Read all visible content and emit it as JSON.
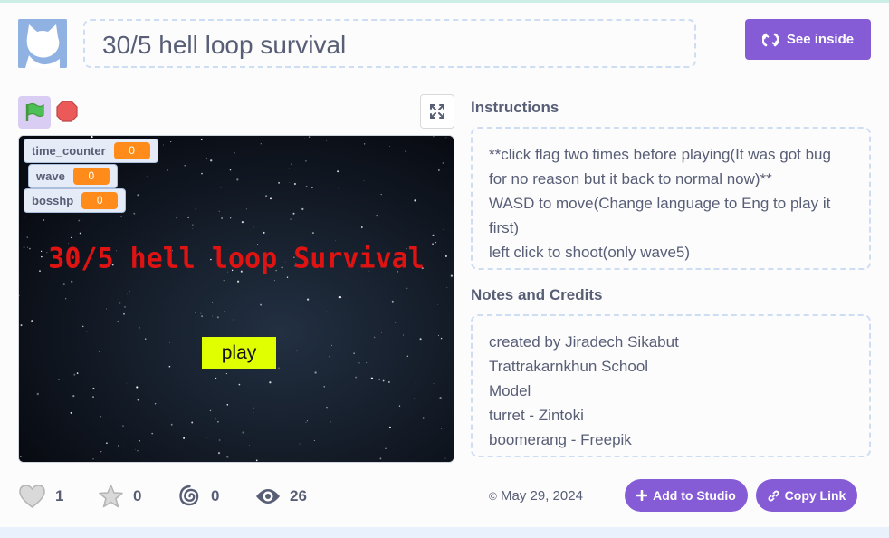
{
  "project": {
    "title": "30/5 hell loop survival"
  },
  "header": {
    "see_inside_label": "See inside"
  },
  "stage": {
    "monitors": [
      {
        "label": "time_counter",
        "value": "0"
      },
      {
        "label": "wave",
        "value": "0"
      },
      {
        "label": "bosshp",
        "value": "0"
      }
    ],
    "game_title": "30/5 hell loop Survival",
    "play_button": "play"
  },
  "instructions": {
    "heading": "Instructions",
    "lines": [
      "**click flag two times before playing(It was got bug",
      "for no reason but it back to normal now)**",
      "WASD to move(Change language to Eng to play it",
      "first)",
      "left click to shoot(only wave5)"
    ]
  },
  "notes": {
    "heading": "Notes and Credits",
    "lines": [
      "created by Jiradech Sikabut",
      "Trattrakarnkhun School",
      "Model",
      "turret - Zintoki",
      "boomerang - Freepik"
    ]
  },
  "stats": {
    "loves": "1",
    "favorites": "0",
    "remixes": "0",
    "views": "26"
  },
  "footer": {
    "date": "May 29, 2024",
    "add_to_studio": "Add to Studio",
    "copy_link": "Copy Link"
  },
  "colors": {
    "accent": "#855cd6",
    "monitor_value": "#ff8c1a",
    "game_title": "#e01313",
    "play_button": "#e0ff00"
  },
  "icons": [
    "scratch-cat-icon",
    "remix-icon",
    "green-flag-icon",
    "stop-icon",
    "fullscreen-icon",
    "heart-icon",
    "star-icon",
    "spiral-icon",
    "eye-icon",
    "copyright-icon",
    "plus-icon",
    "link-icon"
  ]
}
